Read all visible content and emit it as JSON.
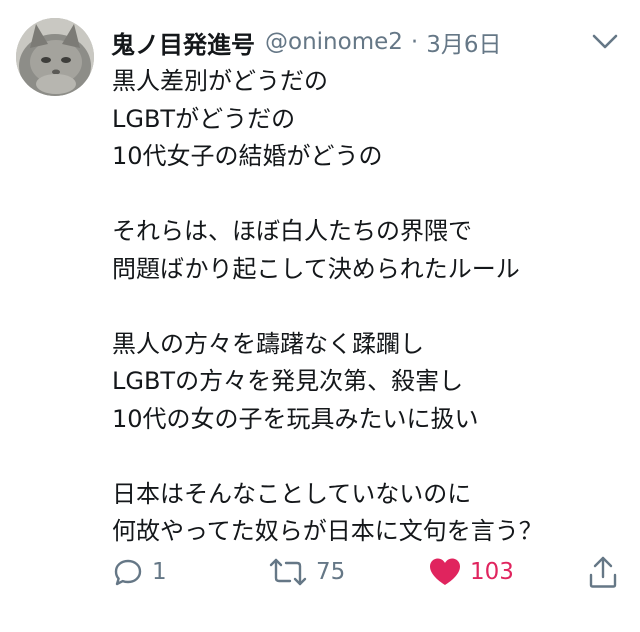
{
  "tweet": {
    "author": {
      "display_name": "鬼ノ目発進号",
      "handle": "@oninome2",
      "separator": "·",
      "date": "3月6日"
    },
    "lines": [
      "黒人差別がどうだの",
      "LGBTがどうだの",
      "10代女子の結婚がどうの",
      "",
      "それらは、ほぼ白人たちの界隈で",
      "問題ばかり起こして決められたルール",
      "",
      "黒人の方々を躊躇なく蹂躙し",
      "LGBTの方々を発見次第、殺害し",
      "10代の女の子を玩具みたいに扱い",
      "",
      "日本はそんなことしていないのに",
      "何故やってた奴らが日本に文句を言う？"
    ],
    "actions": {
      "reply": {
        "icon": "reply-icon",
        "count": "1"
      },
      "retweet": {
        "icon": "retweet-icon",
        "count": "75"
      },
      "like": {
        "icon": "heart-icon",
        "count": "103",
        "liked": true
      },
      "share": {
        "icon": "share-icon"
      }
    }
  },
  "colors": {
    "text": "#14171a",
    "secondary": "#657786",
    "like": "#e0245e"
  }
}
